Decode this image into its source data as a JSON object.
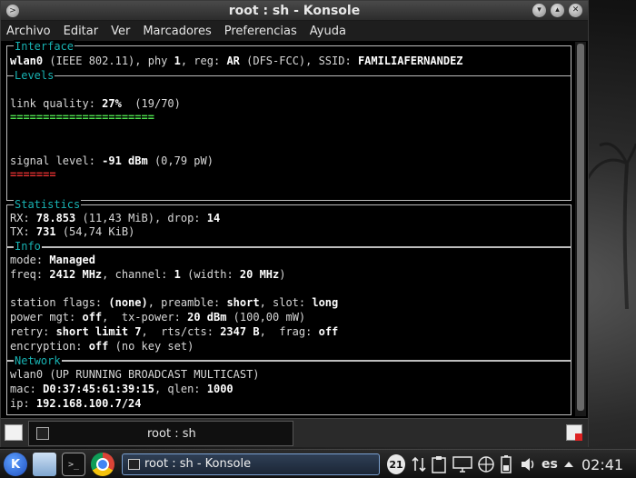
{
  "window": {
    "title": "root : sh - Konsole",
    "minimize_label": "▾",
    "maximize_label": "▴",
    "close_label": "✕"
  },
  "menu": {
    "items": [
      "Archivo",
      "Editar",
      "Ver",
      "Marcadores",
      "Preferencias",
      "Ayuda"
    ]
  },
  "terminal": {
    "sections": {
      "interface": "Interface",
      "levels": "Levels",
      "statistics": "Statistics",
      "info": "Info",
      "network": "Network"
    },
    "interface_line": {
      "iface": "wlan0",
      "std": " (IEEE 802.11), phy ",
      "phy": "1",
      "reg_label": ", reg: ",
      "reg": "AR",
      "reg_dfs": " (DFS-FCC), SSID: ",
      "ssid": "FAMILIAFERNANDEZ"
    },
    "link_quality": {
      "label": "link quality: ",
      "percent": "27%",
      "ratio": "  (19/70)",
      "bar": "======================"
    },
    "signal_level": {
      "label": "signal level: ",
      "value": "-91 dBm",
      "mw": " (0,79 pW)",
      "bar": "======="
    },
    "stats": {
      "rx_label": "RX: ",
      "rx": "78.853",
      "rx_size": " (11,43 MiB), drop: ",
      "drop": "14",
      "tx_label": "TX: ",
      "tx": "731",
      "tx_size": " (54,74 KiB)"
    },
    "info": {
      "mode_label": "mode: ",
      "mode": "Managed",
      "freq_label": "freq: ",
      "freq": "2412 MHz",
      "channel_label": ", channel: ",
      "channel": "1",
      "width_label": " (width: ",
      "width": "20 MHz",
      "width_close": ")",
      "flags_label": "station flags: ",
      "flags": "(none)",
      "preamble_label": ", preamble: ",
      "preamble": "short",
      "slot_label": ", slot: ",
      "slot": "long",
      "power_label": "power mgt: ",
      "power": "off",
      "txpower_label": ",  tx-power: ",
      "txpower": "20 dBm",
      "txpower_mw": " (100,00 mW)",
      "retry_label": "retry: ",
      "retry": "short limit 7",
      "rts_label": ",  rts/cts: ",
      "rts": "2347 B",
      "frag_label": ",  frag: ",
      "frag": "off",
      "enc_label": "encryption: ",
      "enc": "off",
      "enc_note": " (no key set)"
    },
    "network": {
      "flags_line": "wlan0 (UP RUNNING BROADCAST MULTICAST)",
      "mac_label": "mac: ",
      "mac": "D0:37:45:61:39:15",
      "qlen_label": ", qlen: ",
      "qlen": "1000",
      "ip_label": "ip: ",
      "ip": "192.168.100.7/24"
    }
  },
  "tabs": {
    "active_label": "root : sh"
  },
  "taskbar": {
    "kde_label": "K",
    "task_label": "root : sh - Konsole",
    "badge": "21",
    "lang": "es",
    "clock": "02:41",
    "term_icon_text": ">_"
  },
  "colors": {
    "good_bar": "#4ee04e",
    "bad_bar": "#e03030",
    "section": "#18b2b2"
  }
}
